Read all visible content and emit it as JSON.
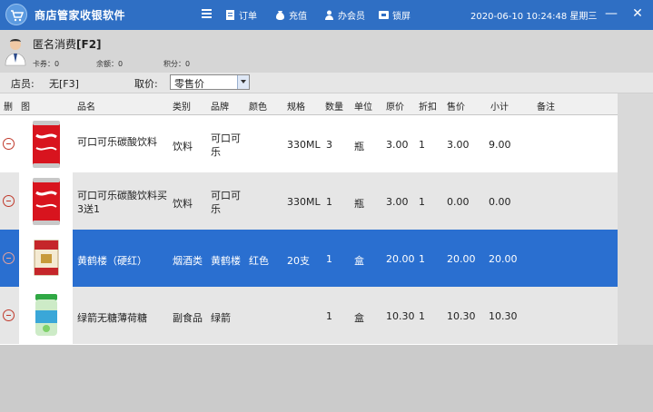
{
  "app": {
    "title": "商店管家收银软件",
    "datetime": "2020-06-10 10:24:48 星期三"
  },
  "nav": [
    {
      "label": "",
      "icon": "menu-icon"
    },
    {
      "label": "订单",
      "icon": "order-icon"
    },
    {
      "label": "充值",
      "icon": "recharge-icon"
    },
    {
      "label": "办会员",
      "icon": "member-icon"
    },
    {
      "label": "锁屏",
      "icon": "lock-icon"
    }
  ],
  "member": {
    "name": "匿名消费",
    "hotkey": "[F2]",
    "card_label": "卡券：",
    "card_value": "0",
    "balance_label": "余额：",
    "balance_value": "0",
    "points_label": "积分：",
    "points_value": "0"
  },
  "staff": {
    "label": "店员:",
    "value": "无[F3]",
    "price_label": "取价:",
    "price_value": "零售价"
  },
  "table": {
    "columns": [
      "删",
      "图",
      "品名",
      "类别",
      "品牌",
      "颜色",
      "规格",
      "数量",
      "单位",
      "原价",
      "折扣",
      "售价",
      "小计",
      "备注"
    ],
    "rows": [
      {
        "name": "可口可乐碳酸饮料",
        "category": "饮料",
        "brand": "可口可乐",
        "color": "",
        "spec": "330ML",
        "qty": "3",
        "unit": "瓶",
        "orig": "3.00",
        "disc": "1",
        "price": "3.00",
        "subtotal": "9.00",
        "note": "",
        "image": "coca-cola-can"
      },
      {
        "name": "可口可乐碳酸饮料买3送1",
        "category": "饮料",
        "brand": "可口可乐",
        "color": "",
        "spec": "330ML",
        "qty": "1",
        "unit": "瓶",
        "orig": "3.00",
        "disc": "1",
        "price": "0.00",
        "subtotal": "0.00",
        "note": "",
        "image": "coca-cola-can"
      },
      {
        "name": "黄鹤楼（硬红）",
        "category": "烟酒类",
        "brand": "黄鹤楼",
        "color": "红色",
        "spec": "20支",
        "qty": "1",
        "unit": "盒",
        "orig": "20.00",
        "disc": "1",
        "price": "20.00",
        "subtotal": "20.00",
        "note": "",
        "image": "cigarette-pack"
      },
      {
        "name": "绿箭无糖薄荷糖",
        "category": "副食品",
        "brand": "绿箭",
        "color": "",
        "spec": "",
        "qty": "1",
        "unit": "盒",
        "orig": "10.30",
        "disc": "1",
        "price": "10.30",
        "subtotal": "10.30",
        "note": "",
        "image": "mint-bottle"
      }
    ]
  },
  "colors": {
    "titlebar": "#2f6fc4",
    "selected_row": "#2a6fd0"
  }
}
